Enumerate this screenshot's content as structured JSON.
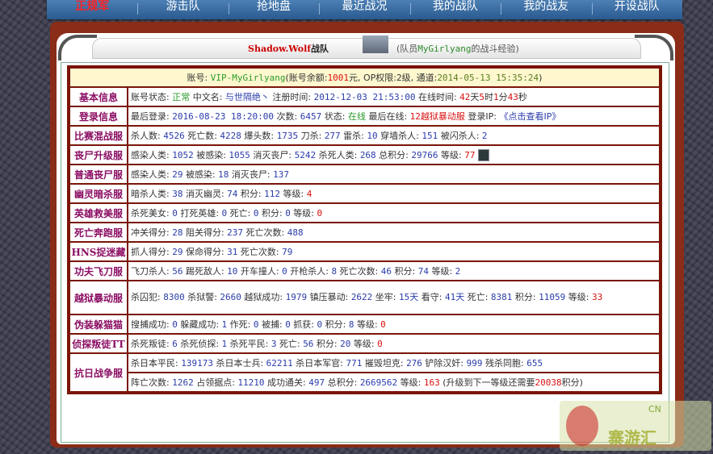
{
  "nav": {
    "items": [
      "正规军",
      "游击队",
      "抢地盘",
      "最近战况",
      "我的战队",
      "我的战友",
      "开设战队"
    ],
    "active_index": 0
  },
  "header": {
    "team_name": "Shadow.Wolf",
    "team_suffix": "战队",
    "member_exp_prefix": "(队员",
    "member_name": "MyGirlyang",
    "member_exp_suffix": "的战斗经验)"
  },
  "account": {
    "label": "账号:",
    "name": "VIP-MyGirlyang",
    "balance_label": "(账号余额:",
    "balance": "1001",
    "balance_unit": "元, OP权限:",
    "op_level": "2",
    "op_unit": "级, 通道:",
    "channel_date": "2014-05-13 15:35:24",
    "close": ")"
  },
  "rows": [
    {
      "label": "基本信息",
      "parts": [
        [
          "t",
          "账号状态: "
        ],
        [
          "green",
          "正常"
        ],
        [
          "t",
          " 中文名: "
        ],
        [
          "blue",
          "与世隔绝丶"
        ],
        [
          "t",
          " 注册时间: "
        ],
        [
          "num",
          "2012-12-03 21:53:00"
        ],
        [
          "t",
          " 在线时间: "
        ],
        [
          "red",
          "42"
        ],
        [
          "t",
          "天"
        ],
        [
          "red",
          "5"
        ],
        [
          "t",
          "时"
        ],
        [
          "red",
          "1"
        ],
        [
          "t",
          "分"
        ],
        [
          "red",
          "43"
        ],
        [
          "t",
          "秒"
        ]
      ]
    },
    {
      "label": "登录信息",
      "parts": [
        [
          "t",
          "最后登录: "
        ],
        [
          "num",
          "2016-08-23 18:20:00"
        ],
        [
          "t",
          " 次数: "
        ],
        [
          "num",
          "6457"
        ],
        [
          "t",
          " 状态: "
        ],
        [
          "green",
          "在线"
        ],
        [
          "t",
          " 最后在线: "
        ],
        [
          "red",
          "12越狱暴动服"
        ],
        [
          "t",
          " 登录IP: "
        ],
        [
          "blue",
          "《点击查看IP》"
        ]
      ]
    },
    {
      "label": "比赛混战服",
      "parts": [
        [
          "t",
          "杀人数: "
        ],
        [
          "num",
          "4526"
        ],
        [
          "t",
          " 死亡数: "
        ],
        [
          "num",
          "4228"
        ],
        [
          "t",
          " 爆头数: "
        ],
        [
          "num",
          "1735"
        ],
        [
          "t",
          " 刀杀: "
        ],
        [
          "num",
          "277"
        ],
        [
          "t",
          " 雷杀: "
        ],
        [
          "num",
          "10"
        ],
        [
          "t",
          " 穿墙杀人: "
        ],
        [
          "num",
          "151"
        ],
        [
          "t",
          " 被闪杀人: "
        ],
        [
          "num",
          "2"
        ]
      ]
    },
    {
      "label": "丧尸升级服",
      "avatar": true,
      "parts": [
        [
          "t",
          "感染人类: "
        ],
        [
          "num",
          "1052"
        ],
        [
          "t",
          " 被感染: "
        ],
        [
          "num",
          "1055"
        ],
        [
          "t",
          " 消灭丧尸: "
        ],
        [
          "num",
          "5242"
        ],
        [
          "t",
          " 杀死人类: "
        ],
        [
          "num",
          "268"
        ],
        [
          "t",
          " 总积分: "
        ],
        [
          "num",
          "29766"
        ],
        [
          "t",
          " 等级: "
        ],
        [
          "red",
          "77"
        ],
        [
          "t",
          " "
        ]
      ]
    },
    {
      "label": "普通丧尸服",
      "parts": [
        [
          "t",
          "感染人类: "
        ],
        [
          "num",
          "29"
        ],
        [
          "t",
          " 被感染: "
        ],
        [
          "num",
          "18"
        ],
        [
          "t",
          " 消灭丧尸: "
        ],
        [
          "num",
          "137"
        ]
      ]
    },
    {
      "label": "幽灵暗杀服",
      "parts": [
        [
          "t",
          "暗杀人类: "
        ],
        [
          "num",
          "38"
        ],
        [
          "t",
          " 消灭幽灵: "
        ],
        [
          "num",
          "74"
        ],
        [
          "t",
          " 积分: "
        ],
        [
          "num",
          "112"
        ],
        [
          "t",
          " 等级: "
        ],
        [
          "red",
          "4"
        ]
      ]
    },
    {
      "label": "英雄救美服",
      "parts": [
        [
          "t",
          "杀死美女: "
        ],
        [
          "num",
          "0"
        ],
        [
          "t",
          " 打死英雄: "
        ],
        [
          "num",
          "0"
        ],
        [
          "t",
          " 死亡: "
        ],
        [
          "num",
          "0"
        ],
        [
          "t",
          " 积分: "
        ],
        [
          "num",
          "0"
        ],
        [
          "t",
          " 等级: "
        ],
        [
          "red",
          "0"
        ]
      ]
    },
    {
      "label": "死亡奔跑服",
      "parts": [
        [
          "t",
          "冲关得分: "
        ],
        [
          "num",
          "28"
        ],
        [
          "t",
          " 阻关得分: "
        ],
        [
          "num",
          "237"
        ],
        [
          "t",
          " 死亡次数: "
        ],
        [
          "num",
          "488"
        ]
      ]
    },
    {
      "label": "HNS捉迷藏",
      "parts": [
        [
          "t",
          "抓人得分: "
        ],
        [
          "num",
          "29"
        ],
        [
          "t",
          " 保命得分: "
        ],
        [
          "num",
          "31"
        ],
        [
          "t",
          " 死亡次数: "
        ],
        [
          "num",
          "79"
        ]
      ]
    },
    {
      "label": "功夫飞刀服",
      "parts": [
        [
          "t",
          "飞刀杀人: "
        ],
        [
          "num",
          "56"
        ],
        [
          "t",
          " 踢死敌人: "
        ],
        [
          "num",
          "10"
        ],
        [
          "t",
          " 开车撞人: "
        ],
        [
          "num",
          "0"
        ],
        [
          "t",
          " 开枪杀人: "
        ],
        [
          "num",
          "8"
        ],
        [
          "t",
          " 死亡次数: "
        ],
        [
          "num",
          "46"
        ],
        [
          "t",
          " 积分: "
        ],
        [
          "num",
          "74"
        ],
        [
          "t",
          " 等级: "
        ],
        [
          "num",
          "2"
        ]
      ]
    },
    {
      "label": "越狱暴动服",
      "wrap": true,
      "parts": [
        [
          "t",
          "杀囚犯: "
        ],
        [
          "num",
          "8300"
        ],
        [
          "t",
          " 杀狱警: "
        ],
        [
          "num",
          "2660"
        ],
        [
          "t",
          " 越狱成功: "
        ],
        [
          "num",
          "1979"
        ],
        [
          "t",
          " 镇压暴动: "
        ],
        [
          "num",
          "2622"
        ],
        [
          "t",
          " 坐牢: "
        ],
        [
          "num",
          "15天"
        ],
        [
          "t",
          " 看守: "
        ],
        [
          "num",
          "41天"
        ],
        [
          "t",
          " 死亡: "
        ],
        [
          "num",
          "8381"
        ],
        [
          "t",
          " 积分: "
        ],
        [
          "num",
          "11059"
        ],
        [
          "t",
          " 等级: "
        ],
        [
          "red",
          "33"
        ]
      ]
    },
    {
      "label": "伪装躲猫猫",
      "parts": [
        [
          "t",
          "搜捕成功: "
        ],
        [
          "num",
          "0"
        ],
        [
          "t",
          " 躲藏成功: "
        ],
        [
          "num",
          "1"
        ],
        [
          "t",
          " 作死: "
        ],
        [
          "num",
          "0"
        ],
        [
          "t",
          " 被捕: "
        ],
        [
          "num",
          "0"
        ],
        [
          "t",
          " 抓获: "
        ],
        [
          "num",
          "0"
        ],
        [
          "t",
          " 积分: "
        ],
        [
          "num",
          "8"
        ],
        [
          "t",
          " 等级: "
        ],
        [
          "red",
          "0"
        ]
      ]
    },
    {
      "label": "侦探叛徒TT",
      "parts": [
        [
          "t",
          "杀死叛徒: "
        ],
        [
          "num",
          "6"
        ],
        [
          "t",
          " 杀死侦探: "
        ],
        [
          "num",
          "1"
        ],
        [
          "t",
          " 杀死平民: "
        ],
        [
          "num",
          "3"
        ],
        [
          "t",
          " 死亡: "
        ],
        [
          "num",
          "56"
        ],
        [
          "t",
          " 积分: "
        ],
        [
          "num",
          "20"
        ],
        [
          "t",
          " 等级: "
        ],
        [
          "red",
          "0"
        ]
      ]
    },
    {
      "label": "抗日战争服",
      "rowspan_lines": [
        [
          [
            "t",
            "杀日本平民: "
          ],
          [
            "num",
            "139173"
          ],
          [
            "t",
            " 杀日本士兵: "
          ],
          [
            "num",
            "62211"
          ],
          [
            "t",
            " 杀日本军官: "
          ],
          [
            "num",
            "771"
          ],
          [
            "t",
            " 摧毁坦克: "
          ],
          [
            "num",
            "276"
          ],
          [
            "t",
            " 铲除汉奸: "
          ],
          [
            "num",
            "999"
          ],
          [
            "t",
            " 残杀同胞: "
          ],
          [
            "num",
            "655"
          ]
        ],
        [
          [
            "t",
            "阵亡次数: "
          ],
          [
            "num",
            "1262"
          ],
          [
            "t",
            " 占领据点: "
          ],
          [
            "num",
            "11210"
          ],
          [
            "t",
            " 成功通关: "
          ],
          [
            "num",
            "497"
          ],
          [
            "t",
            " 总积分: "
          ],
          [
            "num",
            "2669562"
          ],
          [
            "t",
            " 等级: "
          ],
          [
            "red",
            "163"
          ],
          [
            "t",
            " (升级到下一等级还需要"
          ],
          [
            "red",
            "20038"
          ],
          [
            "t",
            "积分)"
          ]
        ]
      ]
    }
  ],
  "watermark": {
    "text": "寨游汇",
    "url": "CN"
  }
}
